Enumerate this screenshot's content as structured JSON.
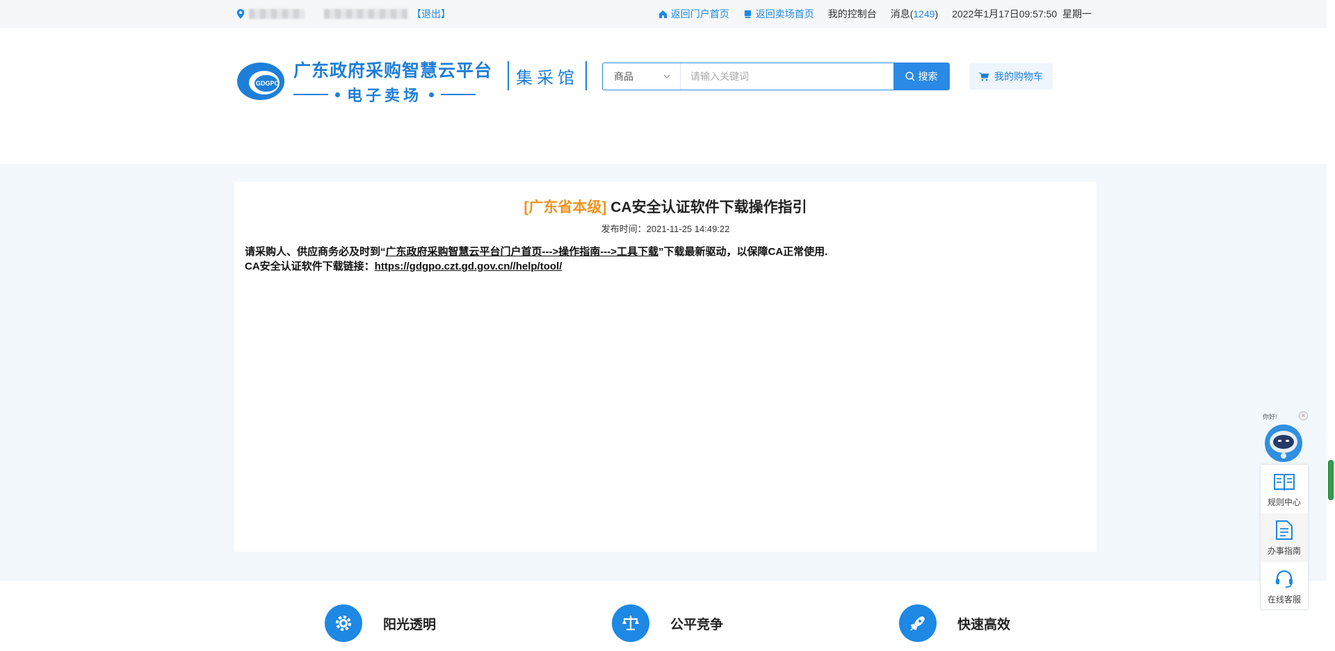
{
  "topbar": {
    "logout_label": "【退出】",
    "links": [
      {
        "label": "返回门户首页",
        "icon": "home-icon"
      },
      {
        "label": "返回卖场首页",
        "icon": "store-icon"
      }
    ],
    "console_label": "我的控制台",
    "message_label": "消息(",
    "message_count": "1249",
    "message_close": ")",
    "datetime": "2022年1月17日09:57:50",
    "weekday": "星期一"
  },
  "header": {
    "logo_badge": "GDGPO",
    "logo_title": "广东政府采购智慧云平台",
    "logo_subtitle": "电子卖场",
    "hall_label": "集采馆",
    "search": {
      "category": "商品",
      "placeholder": "请输入关键词",
      "button_label": "搜索"
    },
    "cart_label": "我的购物车"
  },
  "article": {
    "region": "[广东省本级]",
    "title": "CA安全认证软件下载操作指引",
    "publish_time": "发布时间：2021-11-25 14:49:22",
    "line1_prefix": "请采购人、供应商务必及时到“",
    "line1_link": "广东政府采购智慧云平台门户首页--->操作指南--->工具下载",
    "line1_suffix": "”下载最新驱动，以保障CA正常使用.",
    "line2_prefix": "CA安全认证软件下载链接：",
    "line2_link": "https://gdgpo.czt.gd.gov.cn//help/tool/"
  },
  "features": [
    {
      "label": "阳光透明",
      "icon": "gear-icon"
    },
    {
      "label": "公平竞争",
      "icon": "scale-icon"
    },
    {
      "label": "快速高效",
      "icon": "rocket-icon"
    }
  ],
  "float_panel": {
    "greeting": "你好!",
    "items": [
      {
        "label": "规则中心",
        "icon": "book-icon"
      },
      {
        "label": "办事指南",
        "icon": "document-icon"
      },
      {
        "label": "在线客服",
        "icon": "headset-icon"
      }
    ]
  },
  "colors": {
    "primary": "#1e88e5",
    "region_orange": "#f0931e",
    "main_bg": "#f2f8fc"
  }
}
